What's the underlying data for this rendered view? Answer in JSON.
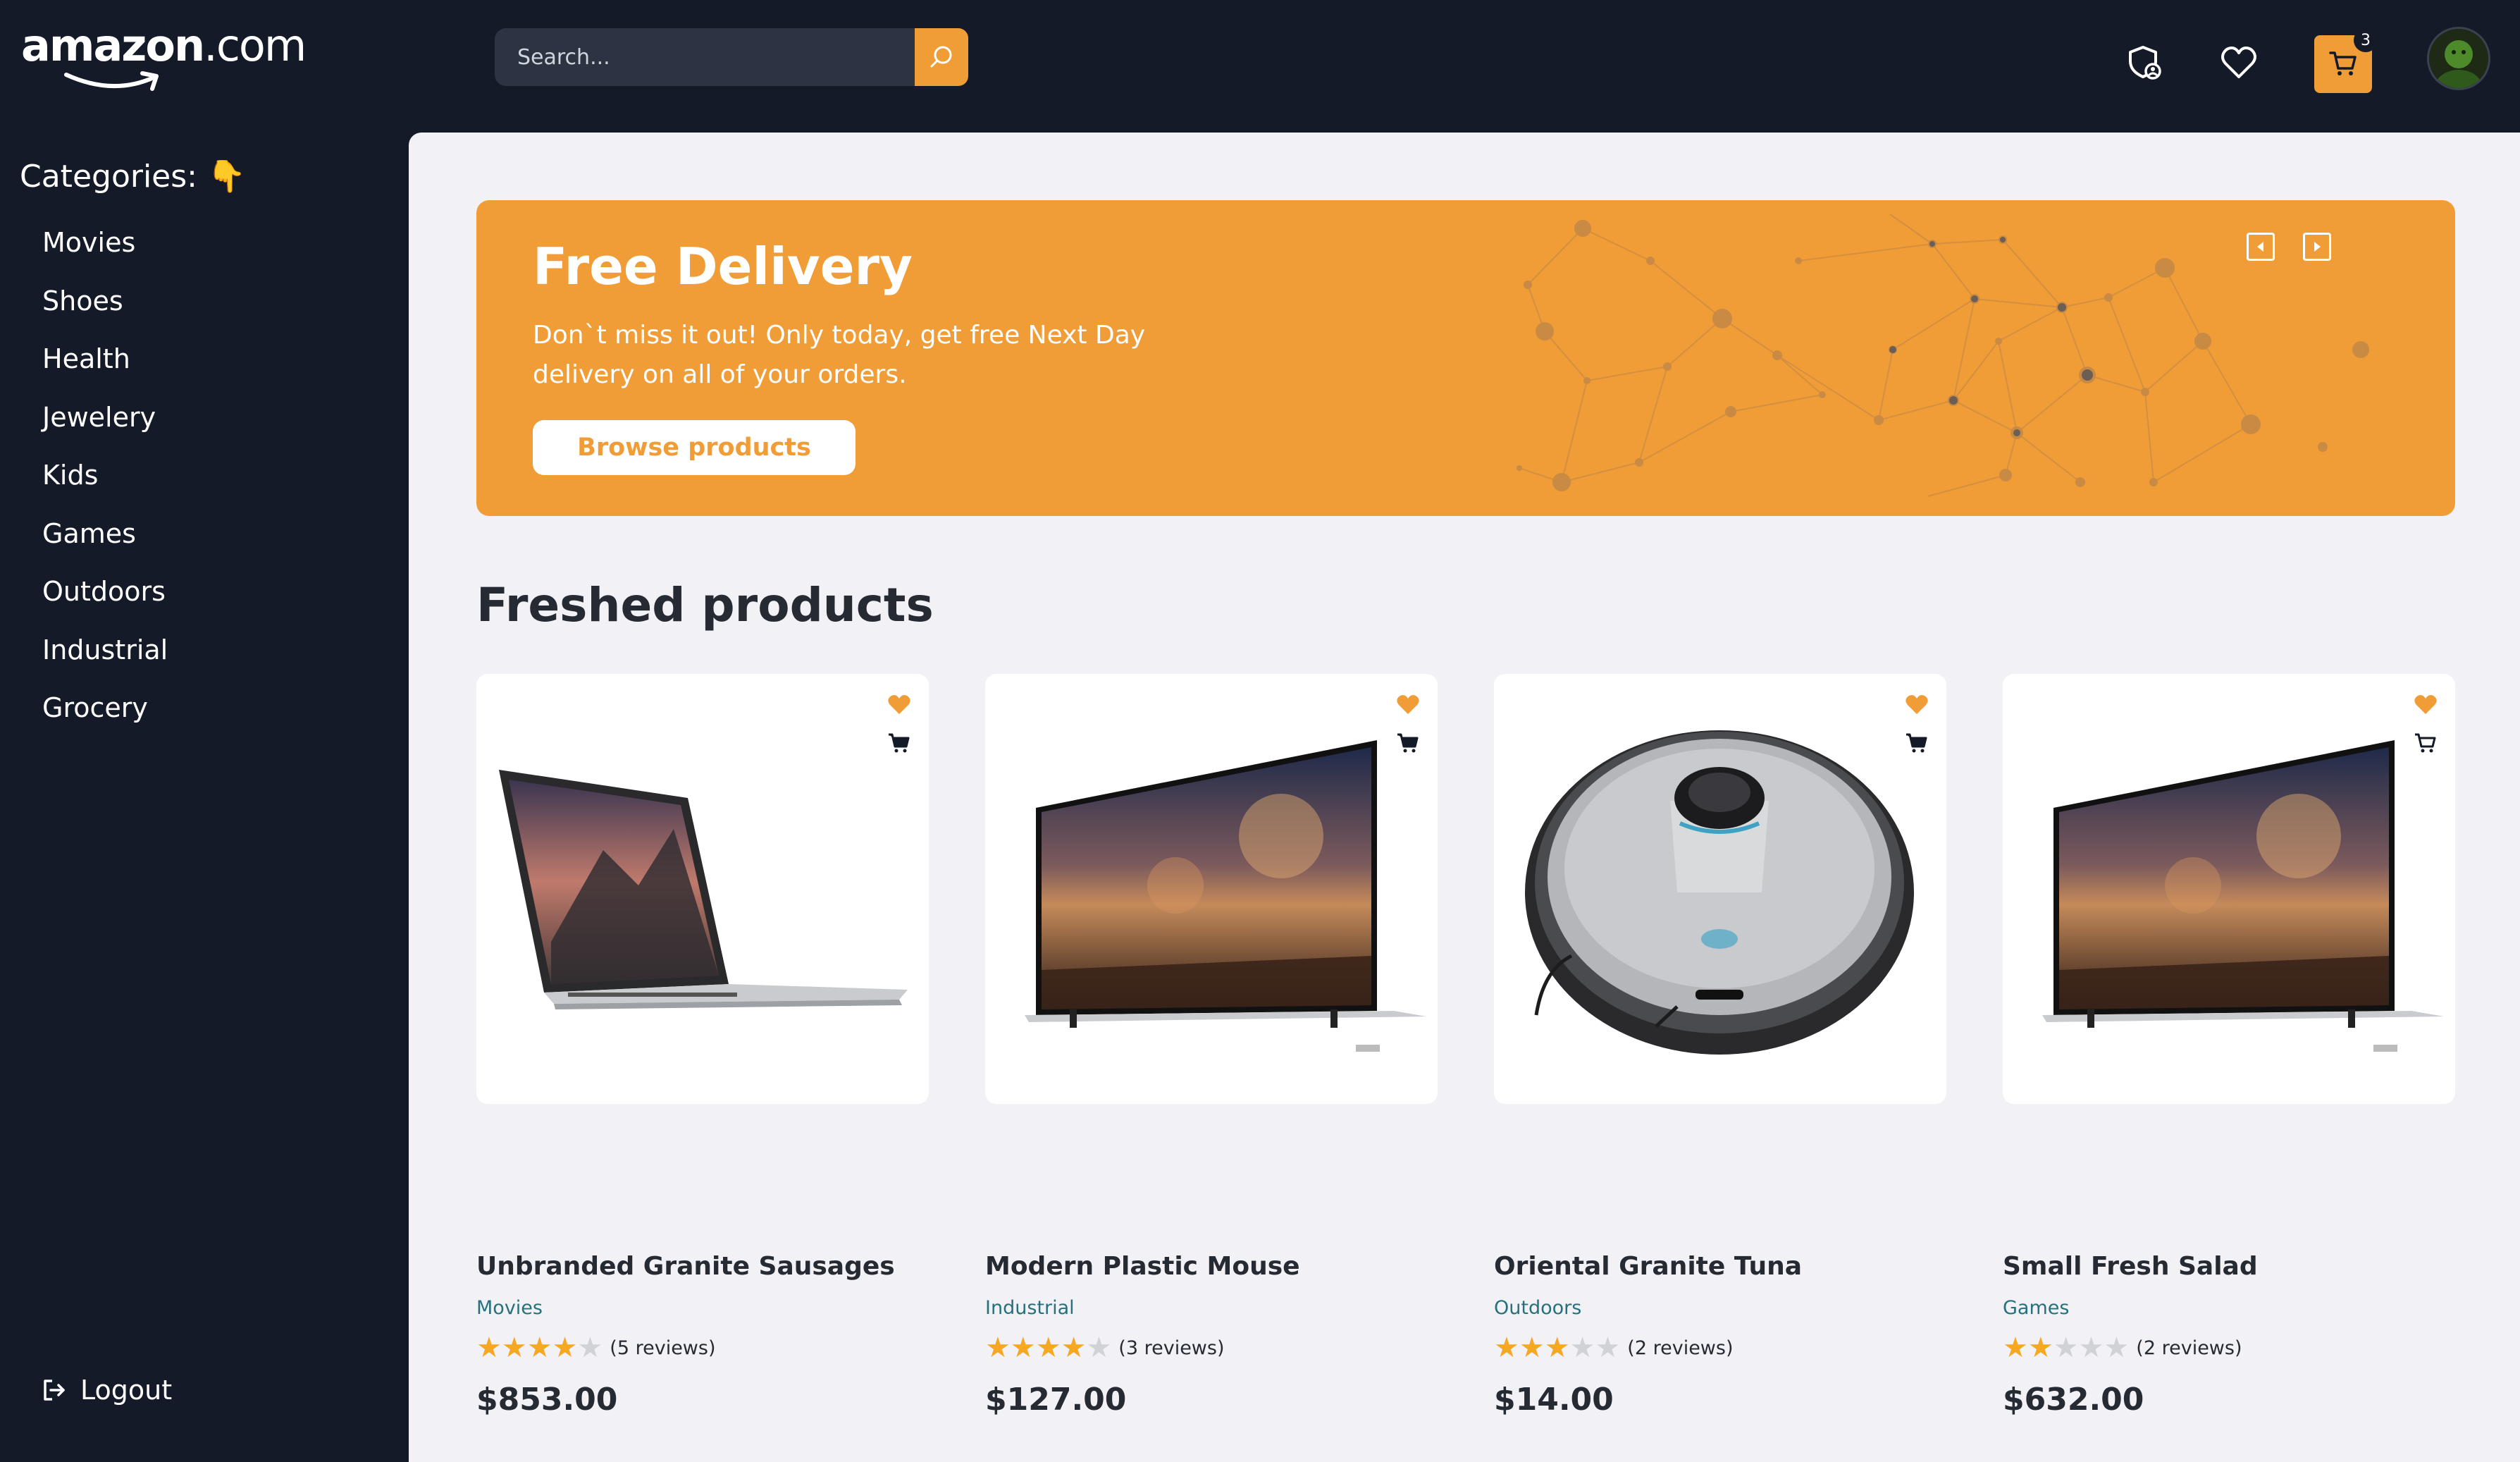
{
  "header": {
    "logo": {
      "brand": "amazon",
      "suffix": ".com"
    },
    "search": {
      "placeholder": "Search...",
      "value": ""
    },
    "cart_count": "3",
    "accent_color": "#f09c37",
    "icons": [
      "shield-user-icon",
      "heart-icon",
      "cart-icon",
      "avatar"
    ]
  },
  "sidebar": {
    "title": "Categories:",
    "title_emoji": "👇",
    "items": [
      {
        "label": "Movies"
      },
      {
        "label": "Shoes"
      },
      {
        "label": "Health"
      },
      {
        "label": "Jewelery"
      },
      {
        "label": "Kids"
      },
      {
        "label": "Games"
      },
      {
        "label": "Outdoors"
      },
      {
        "label": "Industrial"
      },
      {
        "label": "Grocery"
      }
    ],
    "logout_label": "Logout"
  },
  "banner": {
    "title": "Free Delivery",
    "text": "Don`t miss it out! Only today, get free Next Day delivery on all of your orders.",
    "button_label": "Browse products"
  },
  "section": {
    "title": "Freshed products"
  },
  "products": [
    {
      "name": "Unbranded Granite Sausages",
      "category": "Movies",
      "rating": 4,
      "reviews": "(5 reviews)",
      "price": "$853.00",
      "image": "laptop",
      "liked": true
    },
    {
      "name": "Modern Plastic Mouse",
      "category": "Industrial",
      "rating": 4,
      "reviews": "(3 reviews)",
      "price": "$127.00",
      "image": "tv",
      "liked": true
    },
    {
      "name": "Oriental Granite Tuna",
      "category": "Outdoors",
      "rating": 3,
      "reviews": "(2 reviews)",
      "price": "$14.00",
      "image": "robot-vacuum",
      "liked": true
    },
    {
      "name": "Small Fresh Salad",
      "category": "Games",
      "rating": 2,
      "reviews": "(2 reviews)",
      "price": "$632.00",
      "image": "tv",
      "liked": true
    }
  ]
}
